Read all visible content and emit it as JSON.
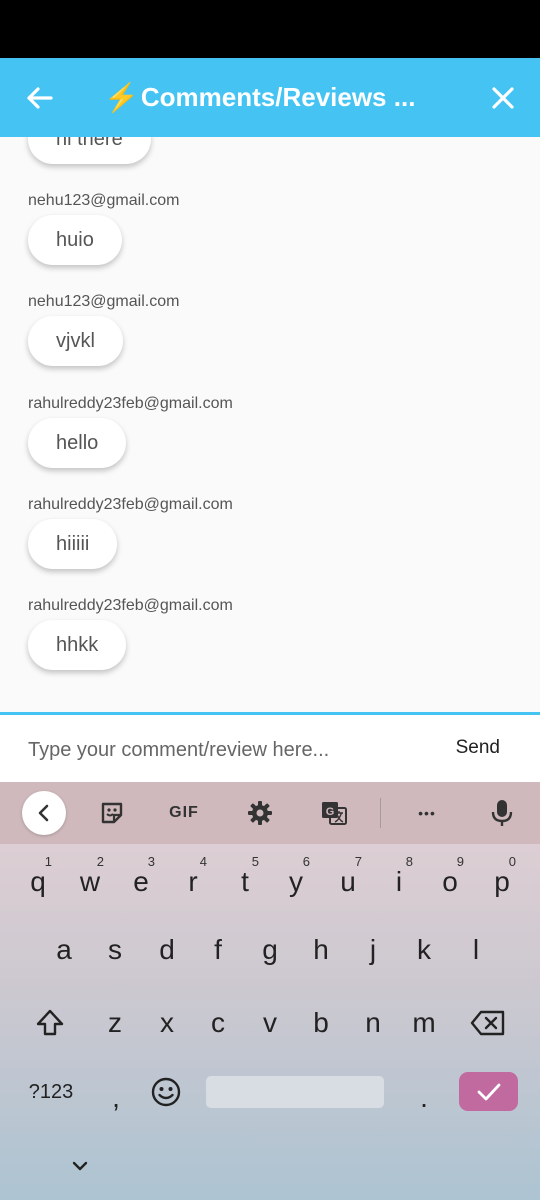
{
  "app_bar": {
    "title_icon": "⚡",
    "title": "Comments/Reviews ...",
    "back_icon": "arrow-left-icon",
    "close_icon": "close-icon",
    "color": "#45c4f4"
  },
  "messages": [
    {
      "email": "",
      "text": "hi there"
    },
    {
      "email": "nehu123@gmail.com",
      "text": "huio"
    },
    {
      "email": "nehu123@gmail.com",
      "text": "vjvkl"
    },
    {
      "email": "rahulreddy23feb@gmail.com",
      "text": "hello"
    },
    {
      "email": "rahulreddy23feb@gmail.com",
      "text": "hiiiii"
    },
    {
      "email": "rahulreddy23feb@gmail.com",
      "text": "hhkk"
    }
  ],
  "composer": {
    "placeholder": "Type your comment/review here...",
    "value": "",
    "send_label": "Send"
  },
  "keyboard": {
    "toolbar": {
      "gif_label": "GIF",
      "more_label": "•••"
    },
    "row1": [
      {
        "key": "q",
        "hint": "1"
      },
      {
        "key": "w",
        "hint": "2"
      },
      {
        "key": "e",
        "hint": "3"
      },
      {
        "key": "r",
        "hint": "4"
      },
      {
        "key": "t",
        "hint": "5"
      },
      {
        "key": "y",
        "hint": "6"
      },
      {
        "key": "u",
        "hint": "7"
      },
      {
        "key": "i",
        "hint": "8"
      },
      {
        "key": "o",
        "hint": "9"
      },
      {
        "key": "p",
        "hint": "0"
      }
    ],
    "row2": [
      "a",
      "s",
      "d",
      "f",
      "g",
      "h",
      "j",
      "k",
      "l"
    ],
    "row3": [
      "z",
      "x",
      "c",
      "v",
      "b",
      "n",
      "m"
    ],
    "row4": {
      "symbols_label": "?123",
      "comma": ",",
      "period": "."
    },
    "enter_color": "#c06aa0"
  }
}
